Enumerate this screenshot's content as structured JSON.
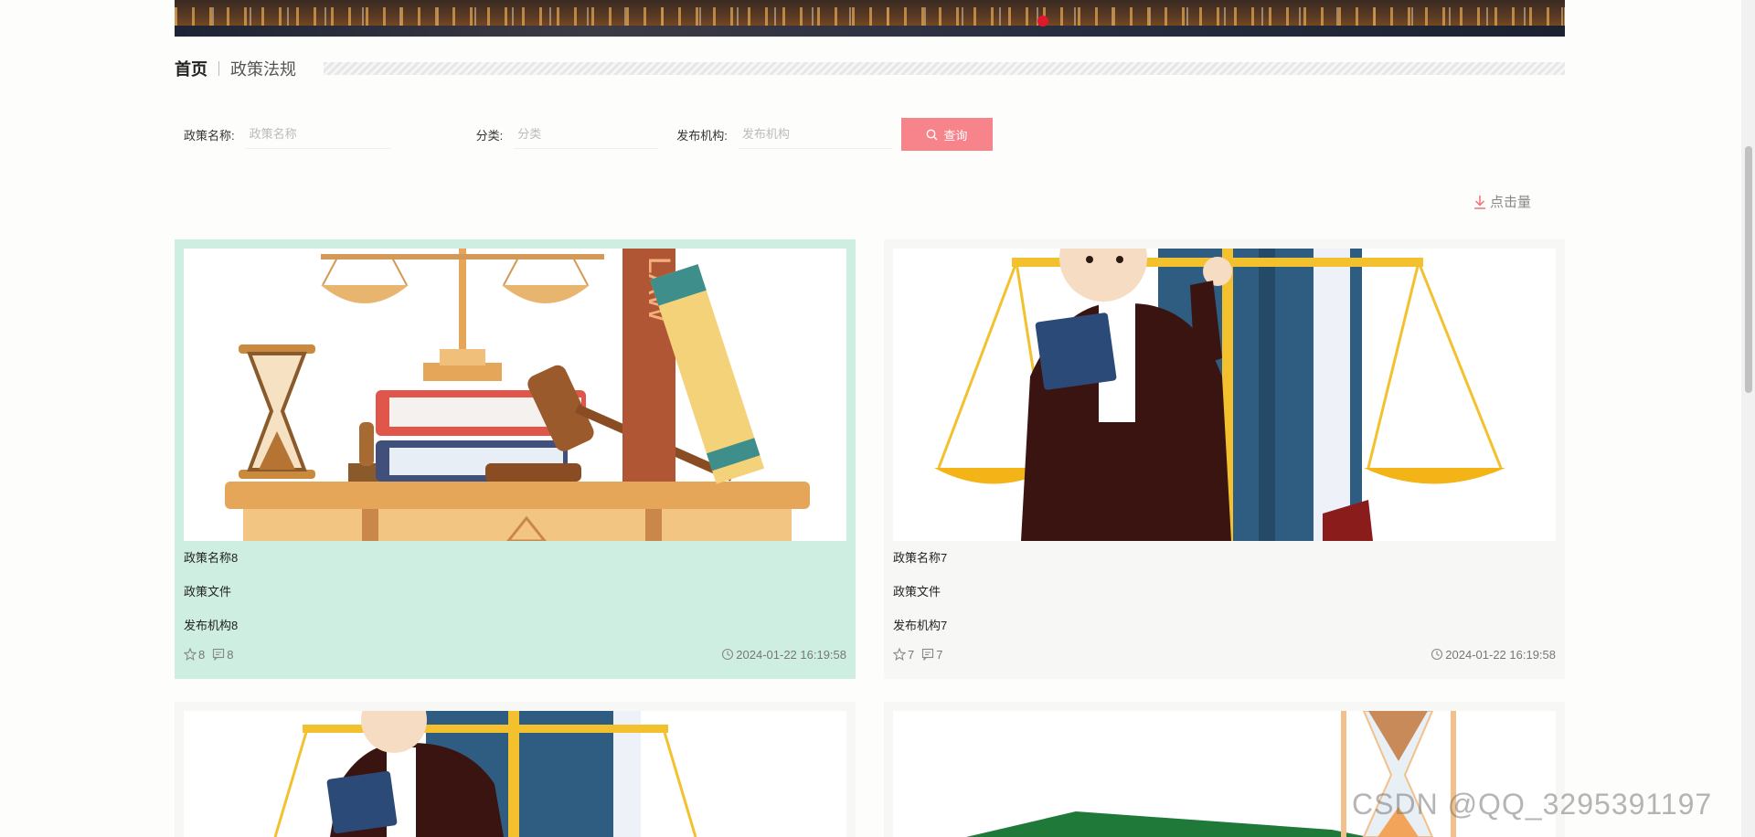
{
  "breadcrumb": {
    "home": "首页",
    "current": "政策法规"
  },
  "search": {
    "fields": [
      {
        "label": "政策名称:",
        "placeholder": "政策名称"
      },
      {
        "label": "分类:",
        "placeholder": "分类"
      },
      {
        "label": "发布机构:",
        "placeholder": "发布机构"
      }
    ],
    "button_label": "查询"
  },
  "sort": {
    "label": "点击量"
  },
  "cards": [
    {
      "name": "政策名称8",
      "category": "政策文件",
      "org": "发布机构8",
      "likes": "8",
      "comments": "8",
      "time": "2024-01-22 16:19:58"
    },
    {
      "name": "政策名称7",
      "category": "政策文件",
      "org": "发布机构7",
      "likes": "7",
      "comments": "7",
      "time": "2024-01-22 16:19:58"
    }
  ],
  "watermark": "CSDN @QQ_3295391197",
  "colors": {
    "accent": "#f7848b",
    "card_active": "#cdeee0",
    "banner_dot": "#e0182e"
  }
}
